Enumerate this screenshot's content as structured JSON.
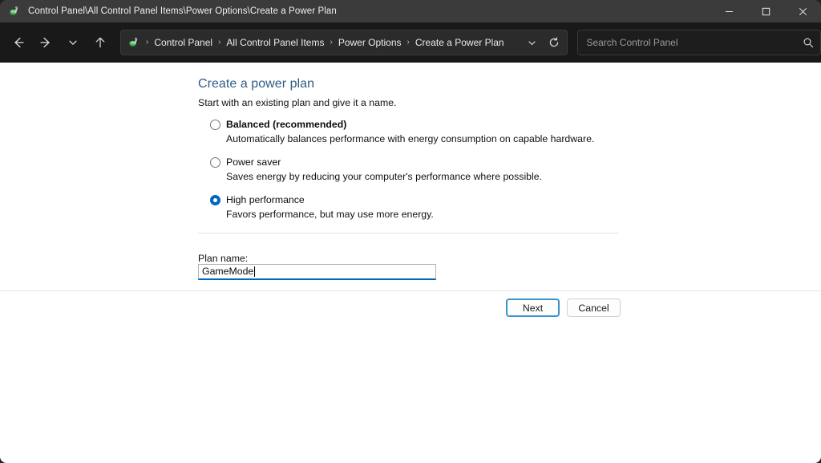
{
  "window": {
    "title": "Control Panel\\All Control Panel Items\\Power Options\\Create a Power Plan",
    "title_icon": "control-panel-icon",
    "controls": {
      "minimize": "minimize-icon",
      "maximize": "maximize-icon",
      "close": "close-icon"
    }
  },
  "toolbar": {
    "nav": {
      "back": "back-arrow-icon",
      "forward": "forward-arrow-icon",
      "recent": "chevron-down-icon",
      "up": "up-arrow-icon"
    },
    "address": {
      "icon": "control-panel-icon",
      "crumbs": [
        "Control Panel",
        "All Control Panel Items",
        "Power Options",
        "Create a Power Plan"
      ],
      "separator": "›",
      "dropdown": "chevron-down-icon",
      "refresh": "refresh-icon"
    },
    "search": {
      "placeholder": "Search Control Panel",
      "value": "",
      "icon": "search-icon"
    }
  },
  "main": {
    "title": "Create a power plan",
    "subtitle": "Start with an existing plan and give it a name.",
    "options": [
      {
        "label": "Balanced (recommended)",
        "description": "Automatically balances performance with energy consumption on capable hardware.",
        "selected": false,
        "bold": true
      },
      {
        "label": "Power saver",
        "description": "Saves energy by reducing your computer's performance where possible.",
        "selected": false,
        "bold": false
      },
      {
        "label": "High performance",
        "description": "Favors performance, but may use more energy.",
        "selected": true,
        "bold": false
      }
    ],
    "plan_name": {
      "label": "Plan name:",
      "value": "GameMode"
    },
    "buttons": {
      "next": "Next",
      "cancel": "Cancel"
    }
  },
  "colors": {
    "titlebar": "#3b3b3b",
    "toolbar": "#191919",
    "content": "#ffffff",
    "heading": "#2d5c88",
    "accent": "#0067c0",
    "default_button_border": "#3a93c9"
  }
}
